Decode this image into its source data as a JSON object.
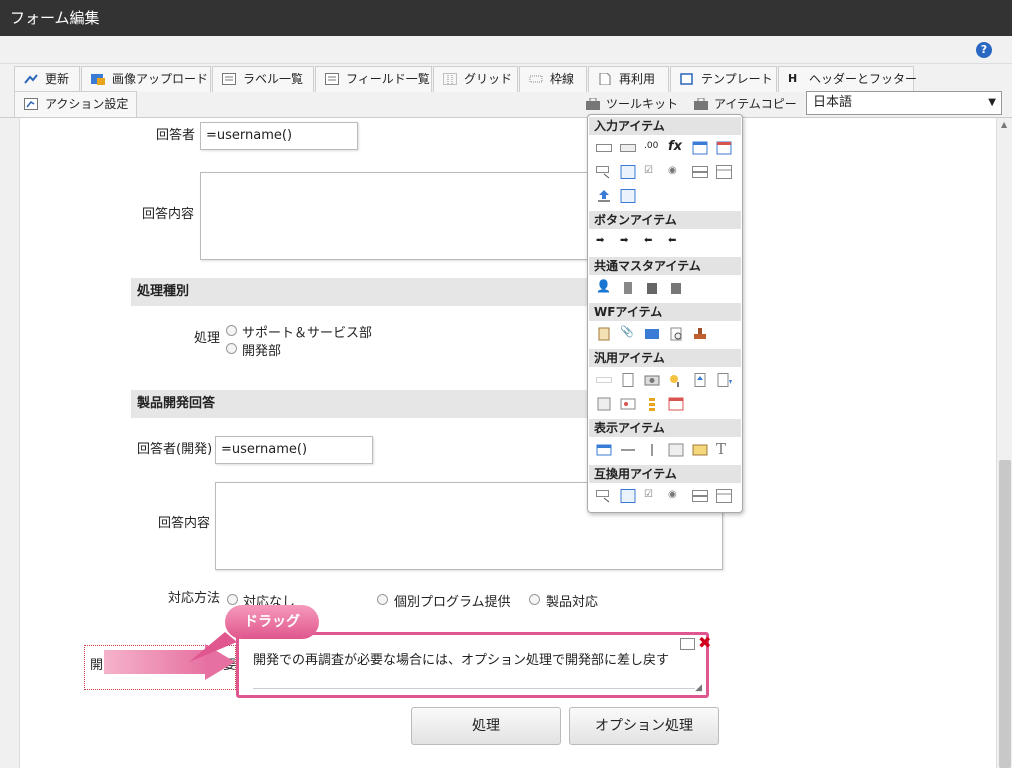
{
  "window": {
    "title": "フォーム編集"
  },
  "help": {
    "label": "?"
  },
  "toolbar": {
    "row1": [
      "更新",
      "画像アップロード",
      "ラベル一覧",
      "フィールド一覧",
      "グリッド",
      "枠線",
      "再利用",
      "テンプレート",
      "ヘッダーとフッター"
    ],
    "row2": [
      "アクション設定"
    ],
    "toolkit": "ツールキット",
    "item_copy": "アイテムコピー",
    "language": "日本語"
  },
  "form": {
    "respondent_label": "回答者",
    "respondent_value": "=username()",
    "answer_label": "回答内容",
    "section_process": "処理種別",
    "process_label": "処理",
    "process_options": [
      "サポート＆サービス部",
      "開発部"
    ],
    "section_dev": "製品開発回答",
    "dev_respondent_label": "回答者(開発)",
    "dev_respondent_value": "=username()",
    "dev_answer_label": "回答内容",
    "method_label": "対応方法",
    "method_options": [
      "対応なし",
      "個別プログラム提供",
      "製品対応"
    ],
    "partial_label": "開",
    "partial_label2": "要",
    "selected_text": "開発での再調査が必要な場合には、オプション処理で開発部に差し戻す",
    "btn_process": "処理",
    "btn_option": "オプション処理"
  },
  "palette": {
    "sections": [
      "入力アイテム",
      "ボタンアイテム",
      "共通マスタアイテム",
      "WFアイテム",
      "汎用アイテム",
      "表示アイテム",
      "互換用アイテム"
    ]
  },
  "annotation": {
    "drag": "ドラッグ"
  },
  "colors": {
    "accent": "#e0568e",
    "titlebar": "#333333"
  }
}
